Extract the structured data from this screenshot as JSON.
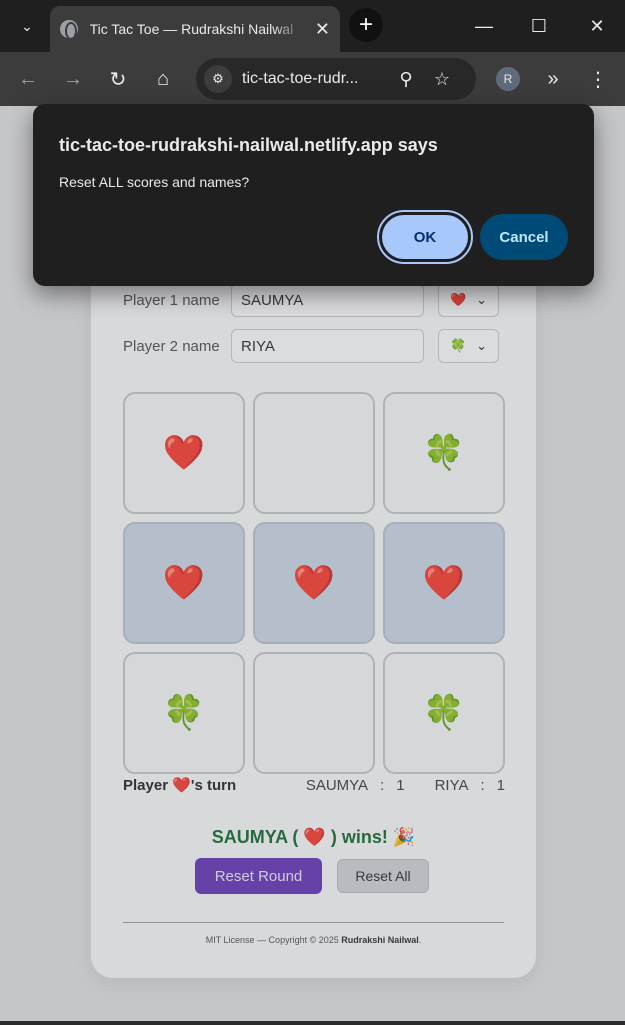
{
  "browser": {
    "tab_title": "Tic Tac Toe — Rudrakshi Nailwal",
    "url": "tic-tac-toe-rudr...",
    "profile_initial": "R",
    "icons": [
      "tab-search-icon",
      "globe-icon",
      "close-icon",
      "plus-icon",
      "minimize-icon",
      "maximize-icon",
      "back-icon",
      "forward-icon",
      "reload-icon",
      "home-icon",
      "site-info-icon",
      "zoom-icon",
      "star-icon",
      "extensions-icon",
      "kebab-menu-icon"
    ]
  },
  "dialog": {
    "title": "tic-tac-toe-rudrakshi-nailwal.netlify.app says",
    "message": "Reset ALL scores and names?",
    "ok_label": "OK",
    "cancel_label": "Cancel",
    "ok_color": "#a8c7fa",
    "cancel_color": "#004a77"
  },
  "game": {
    "player1": {
      "label": "Player 1 name",
      "value": "SAUMYA",
      "symbol": "❤️"
    },
    "player2": {
      "label": "Player 2 name",
      "value": "RIYA",
      "symbol": "🍀"
    },
    "board": [
      "❤️",
      "",
      "🍀",
      "❤️",
      "❤️",
      "❤️",
      "🍀",
      "",
      "🍀"
    ],
    "winning_cells": [
      3,
      4,
      5
    ],
    "turn_prefix": "Player",
    "turn_symbol": "❤️",
    "turn_suffix": "'s turn",
    "score": {
      "p1_name": "SAUMYA",
      "p1_sep": ":",
      "p1_score": "1",
      "p2_name": "RIYA",
      "p2_sep": ":",
      "p2_score": "1"
    },
    "winner_prefix": "SAUMYA (",
    "winner_symbol": "❤️",
    "winner_suffix": ") wins! 🎉",
    "reset_round_label": "Reset Round",
    "reset_all_label": "Reset All",
    "winner_color": "#1f6e3a",
    "reset_round_color": "#6b3fb6"
  },
  "footer": {
    "text": "MIT License — Copyright © 2025 ",
    "author": "Rudrakshi Nailwal",
    "end": "."
  }
}
